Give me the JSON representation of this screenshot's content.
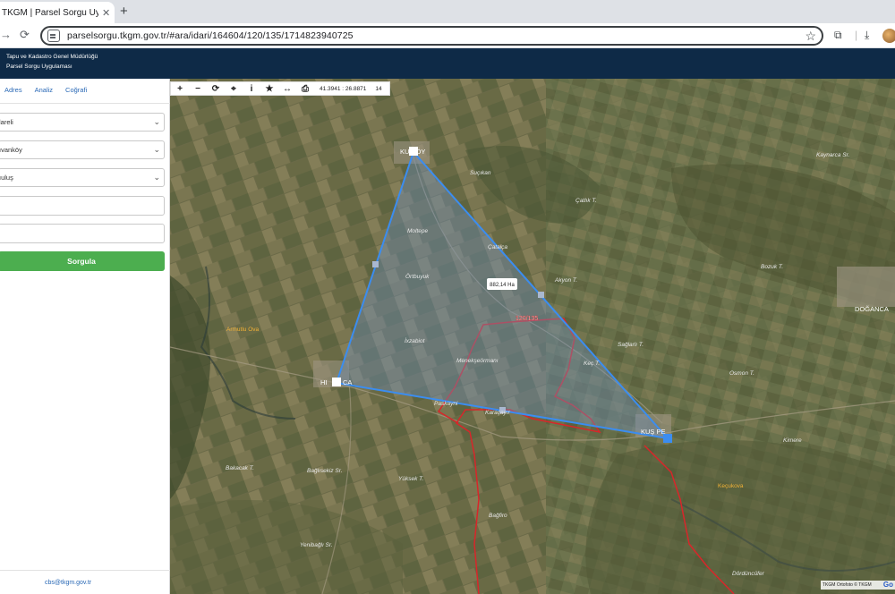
{
  "browser": {
    "tab_title": "TKGM | Parsel Sorgu Uygulam",
    "tab_close": "✕",
    "new_tab": "+",
    "url": "parselsorgu.tkgm.gov.tr/#ara/idari/164604/120/135/1714823940725"
  },
  "header": {
    "org": "Tapu ve Kadastro Genel Müdürlüğü",
    "app": "Parsel Sorgu Uygulaması"
  },
  "sidebar": {
    "tabs": [
      "Adres",
      "Analiz",
      "Coğrafi"
    ],
    "selects": [
      "lareli",
      "ıvanköy",
      "ıuluş"
    ],
    "query_button": "Sorgula",
    "email": "cbs@tkgm.gov.tr"
  },
  "map": {
    "toolbar_icons": [
      "zoom-in-icon",
      "zoom-out-icon",
      "refresh-icon",
      "locate-icon",
      "info-icon",
      "bookmark-icon",
      "measure-icon",
      "print-icon"
    ],
    "toolbar_glyphs": [
      "+",
      "−",
      "⟳",
      "⌖",
      "i",
      "★",
      "↔",
      "⎙"
    ],
    "coords": "41.3941 : 26.8871",
    "zoom": "14",
    "area_label": "882,14 Ha",
    "parcel_label": "120/135",
    "attribution": "TKGM Ortofoto © TKGM",
    "google": "Go",
    "place_labels": {
      "kukoy": "KU  KÖY",
      "hil": "HI",
      "ca": "CA",
      "kuspe": "KUŞ  PE",
      "doganca": "DOĞANCA",
      "armutlu": "Armutlu Ova",
      "kecukova": "Keçukova",
      "sucikan": "Suçıkan",
      "catilik": "Çatlık T.",
      "kaynarca": "Kaynarca Sr.",
      "moltepe": "Moltepe",
      "catalca": "Çatalça",
      "ordbuyuk": "Örtbuyuk",
      "akyon": "Akyon T.",
      "bozuk": "Bozuk T.",
      "ixzabiot": "İxzabiot",
      "menekse": "Menekşeörmanı",
      "paskayni": "Paskayni",
      "karacayir": "Karaçayır",
      "saglarli": "Sağlarlı T.",
      "kec": "Keç T.",
      "osmon": "Osmon T.",
      "kimere": "Kimere",
      "bakacak": "Bakacak T.",
      "baglisekiz": "Bağlısekiz Sr.",
      "yuksek": "Yüksek T.",
      "bagfiro": "Bağfiro",
      "yenibagli": "Yenibağlı Sr.",
      "dorduncu": "Dördüncüfer"
    }
  },
  "colors": {
    "header_bg": "#0e2a47",
    "accent": "#2a69b6",
    "button": "#4cae4f",
    "polygon_stroke": "#3b8df0",
    "parcel_border": "#d8262a"
  }
}
